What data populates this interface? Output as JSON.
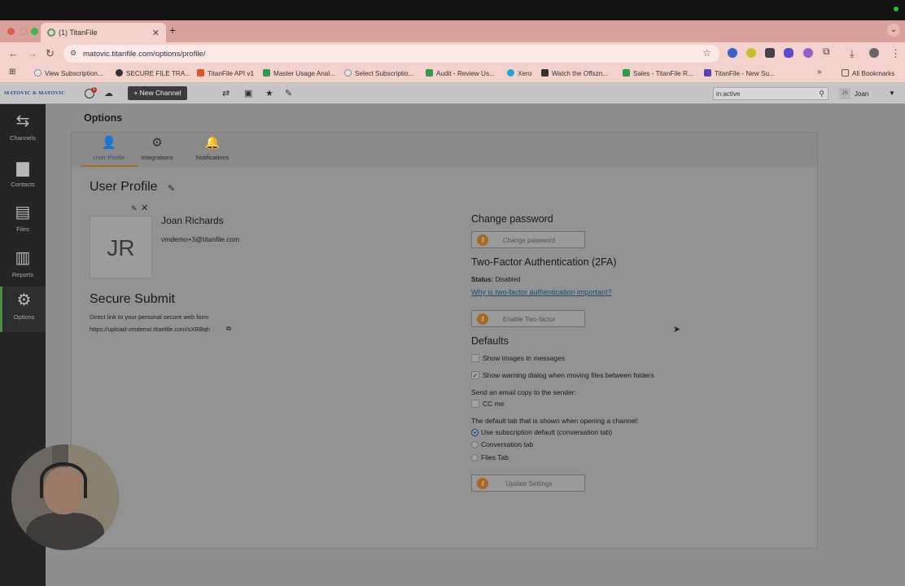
{
  "browser": {
    "tab_title": "(1) TitanFile",
    "new_tab": "+",
    "url": "matovic.titanfile.com/options/profile/",
    "bookmarks": [
      "View Subscription...",
      "SECURE FILE TRA...",
      "TitanFile API v1",
      "Master Usage Anal...",
      "Select Subscriptio...",
      "Audit - Review Us...",
      "Xero",
      "Watch the Offszn...",
      "Sales - TitanFile R...",
      "TitanFile - New Su..."
    ],
    "all_bookmarks": "All Bookmarks"
  },
  "app": {
    "logo": "MATOVIC & MATOVIC",
    "notification_count": "1",
    "new_channel_label": "+ New Channel",
    "search_value": "in:active",
    "user_initials": "JR",
    "user_name": "Joan"
  },
  "sidebar": {
    "items": [
      {
        "label": "Channels",
        "icon": "arrows-icon"
      },
      {
        "label": "Contacts",
        "icon": "contacts-icon"
      },
      {
        "label": "Files",
        "icon": "file-icon"
      },
      {
        "label": "Reports",
        "icon": "bar-chart-icon"
      },
      {
        "label": "Options",
        "icon": "gear-icon"
      }
    ]
  },
  "page": {
    "title": "Options",
    "tabs": [
      {
        "label": "User Profile"
      },
      {
        "label": "Integrations"
      },
      {
        "label": "Notifications"
      }
    ]
  },
  "profile": {
    "heading": "User Profile",
    "initials": "JR",
    "name": "Joan Richards",
    "email": "vmdemo+3@titanfile.com"
  },
  "secure_submit": {
    "heading": "Secure Submit",
    "description": "Direct link to your personal secure web form",
    "link": "https://upload-vmdemo.titanfile.com/sXRBqh"
  },
  "password": {
    "heading": "Change password",
    "button": "Change password"
  },
  "twofa": {
    "heading": "Two-Factor Authentication (2FA)",
    "status_label": "Status:",
    "status_value": "Disabled",
    "why_link": "Why is two-factor authentication important?",
    "button": "Enable Two-factor"
  },
  "defaults": {
    "heading": "Defaults",
    "show_images": "Show images in messages",
    "show_images_checked": false,
    "show_warning": "Show warning dialog when moving files between folders",
    "show_warning_checked": true,
    "email_copy_label": "Send an email copy to the sender:",
    "cc_me": "CC me",
    "cc_me_checked": false,
    "default_tab_label": "The default tab that is shown when opening a channel:",
    "tab_options": [
      "Use subscription default (conversation tab)",
      "Conversation tab",
      "Files Tab"
    ],
    "selected_tab_option": "Use subscription default (conversation tab)",
    "update_button": "Update Settings"
  }
}
